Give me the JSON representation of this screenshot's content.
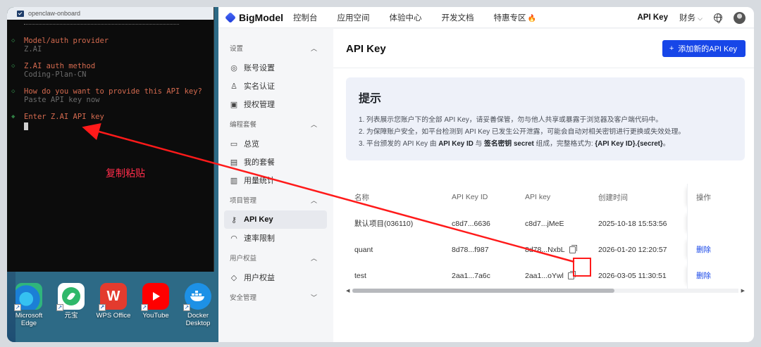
{
  "terminal": {
    "title": "openclaw-onboard",
    "blocks": [
      {
        "label": "Model/auth provider",
        "value": "Z.AI"
      },
      {
        "label": "Z.AI auth method",
        "value": "Coding-Plan-CN"
      },
      {
        "label": "How do you want to provide this API key?",
        "value": "Paste API key now"
      },
      {
        "label": "Enter Z.AI API key",
        "value": ""
      }
    ]
  },
  "annotation": {
    "copy_paste": "复制粘贴"
  },
  "dock": [
    {
      "label": "Microsoft Edge",
      "icon": "edge-icon"
    },
    {
      "label": "元宝",
      "icon": "yuanbao-icon"
    },
    {
      "label": "WPS Office",
      "icon": "wps-icon"
    },
    {
      "label": "YouTube",
      "icon": "youtube-icon"
    },
    {
      "label": "Docker Desktop",
      "icon": "docker-icon"
    }
  ],
  "topbar": {
    "brand": "BigModel",
    "nav": [
      "控制台",
      "应用空间",
      "体验中心",
      "开发文档",
      "特惠专区"
    ],
    "right_active": "API Key",
    "finance": "财务"
  },
  "sidebar": {
    "sections": [
      {
        "title": "设置",
        "items": [
          {
            "label": "账号设置",
            "icon": "gear-circle-icon"
          },
          {
            "label": "实名认证",
            "icon": "user-icon"
          },
          {
            "label": "授权管理",
            "icon": "authorize-icon"
          }
        ]
      },
      {
        "title": "编程套餐",
        "items": [
          {
            "label": "总览",
            "icon": "monitor-icon"
          },
          {
            "label": "我的套餐",
            "icon": "package-icon"
          },
          {
            "label": "用量统计",
            "icon": "bar-chart-icon"
          }
        ]
      },
      {
        "title": "项目管理",
        "items": [
          {
            "label": "API Key",
            "icon": "key-icon",
            "active": true
          },
          {
            "label": "速率限制",
            "icon": "speed-icon"
          }
        ]
      },
      {
        "title": "用户权益",
        "items": [
          {
            "label": "用户权益",
            "icon": "diamond-icon"
          }
        ]
      },
      {
        "title": "安全管理",
        "items": []
      }
    ]
  },
  "main": {
    "title": "API Key",
    "add_button": "添加新的API Key",
    "tips": {
      "title": "提示",
      "lines": [
        "1. 列表展示您账户下的全部 API Key，请妥善保管，勿与他人共享或暴露于浏览器及客户端代码中。",
        "2. 为保障账户安全，如平台检测到 API Key 已发生公开泄露，可能会自动对相关密钥进行更换或失效处理。"
      ],
      "line3": {
        "a": "3. 平台颁发的 API Key 由 ",
        "b": "API Key ID",
        "c": " 与 ",
        "d": "签名密钥 secret",
        "e": " 组成，完整格式为: ",
        "f": "{API Key ID}.{secret}",
        "g": "。"
      }
    },
    "table": {
      "headers": [
        "名称",
        "API Key ID",
        "API key",
        "创建时间",
        "操作"
      ],
      "rows": [
        {
          "name": "默认项目(036110)",
          "key_id": "c8d7...6636",
          "key": "c8d7...jMeE",
          "created": "2025-10-18 15:53:56",
          "op": "",
          "copy": false
        },
        {
          "name": "quant",
          "key_id": "8d78...f987",
          "key": "8d78...NxbL",
          "created": "2026-01-20 12:20:57",
          "op": "删除",
          "copy": true
        },
        {
          "name": "test",
          "key_id": "2aa1...7a6c",
          "key": "2aa1...oYwl",
          "created": "2026-03-05 11:30:51",
          "op": "删除",
          "copy": true
        }
      ]
    }
  },
  "colors": {
    "accent": "#1746e8",
    "annotation_red": "#ff1a1a",
    "terminal_text": "#d46a4f"
  }
}
